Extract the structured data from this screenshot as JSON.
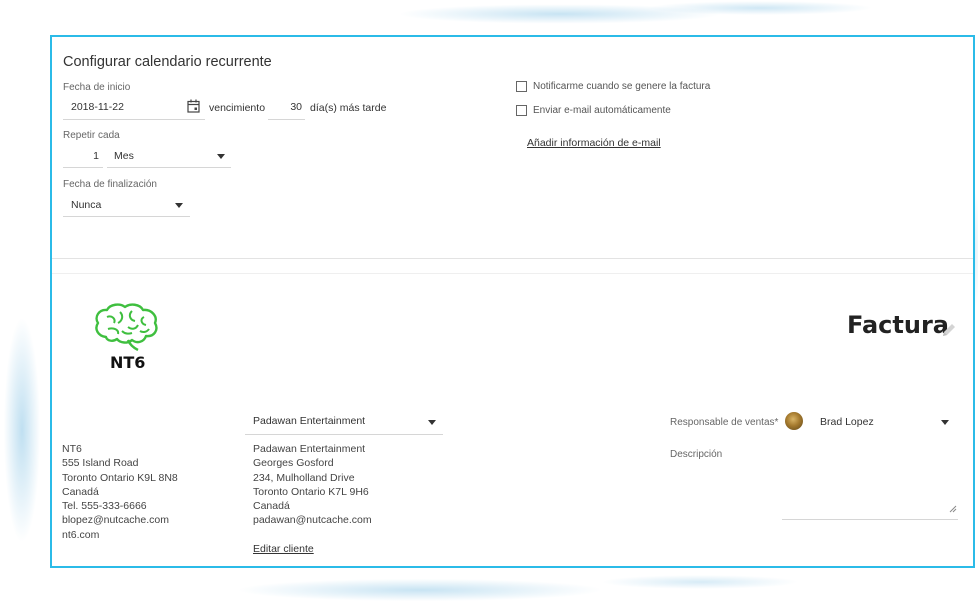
{
  "recurring": {
    "title": "Configurar calendario recurrente",
    "start_date_label": "Fecha de inicio",
    "start_date_value": "2018-11-22",
    "due_label": "vencimiento",
    "due_days": "30",
    "due_suffix": "día(s) más tarde",
    "repeat_label": "Repetir cada",
    "repeat_count": "1",
    "repeat_unit": "Mes",
    "end_date_label": "Fecha de finalización",
    "end_date_value": "Nunca",
    "notify_label": "Notificarme cuando se genere la factura",
    "email_auto_label": "Enviar e-mail automáticamente",
    "add_email_link": "Añadir información de e-mail"
  },
  "invoice": {
    "logo_text": "NT6",
    "heading": "Factura",
    "company_address": [
      "NT6",
      "555 Island Road",
      "Toronto Ontario K9L 8N8",
      "Canadá",
      "Tel. 555-333-6666",
      "blopez@nutcache.com",
      "nt6.com"
    ],
    "client_select_value": "Padawan Entertainment",
    "client_address": [
      "Padawan Entertainment",
      "Georges Gosford",
      "234, Mulholland Drive",
      "Toronto Ontario K7L 9H6",
      "Canadá",
      "padawan@nutcache.com"
    ],
    "edit_client_link": "Editar cliente",
    "sales_rep_label": "Responsable de ventas*",
    "sales_rep_value": "Brad Lopez",
    "description_label": "Descripción",
    "description_value": ""
  },
  "colors": {
    "frame_border": "#2bbbe8",
    "logo_green": "#3fbf3f"
  },
  "icons": [
    "calendar-icon",
    "chevron-down-icon",
    "pencil-icon",
    "brain-logo-icon",
    "avatar"
  ]
}
